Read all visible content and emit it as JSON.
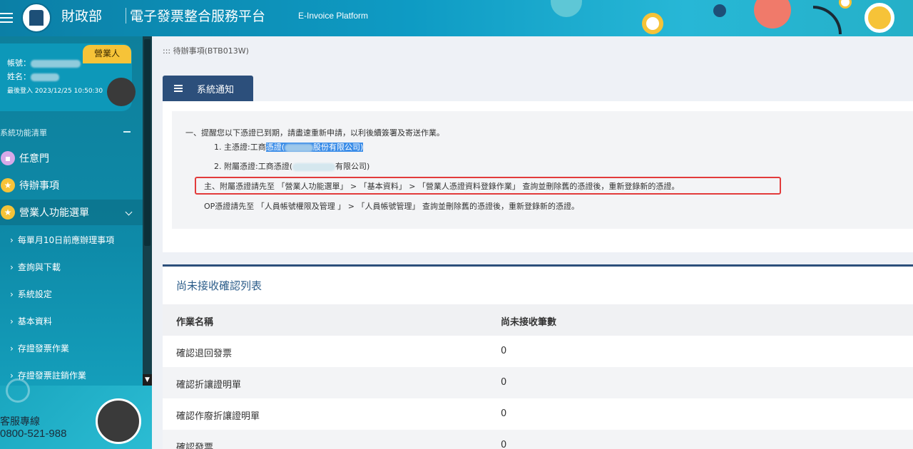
{
  "header": {
    "brand_ministry": "財政部",
    "brand_platform": "電子發票整合服務平台",
    "brand_en": "E-Invoice Platform",
    "colors": {
      "header_bg": "#0e9bc4",
      "accent": "#f6c338",
      "nav_dark": "#2c4f7b"
    }
  },
  "sidebar": {
    "role_badge": "營業人",
    "account_label": "帳號：",
    "account_value": "9 349A CC95",
    "name_label": "姓名：",
    "last_login_label": "最後登入",
    "last_login_value": "2023/12/25 10:50:30",
    "menu_title": "系統功能清單",
    "items": [
      {
        "label": "任意門",
        "icon": "book-icon"
      },
      {
        "label": "待辦事項",
        "icon": "star-icon"
      },
      {
        "label": "營業人功能選單",
        "icon": "star-icon"
      }
    ],
    "sub_items": [
      {
        "label": "每單月10日前應辦理事項"
      },
      {
        "label": "查詢與下載"
      },
      {
        "label": "系統設定"
      },
      {
        "label": "基本資料"
      },
      {
        "label": "存證發票作業"
      },
      {
        "label": "存證發票註銷作業"
      }
    ],
    "support_label": "客服專線",
    "support_phone": "0800-521-988"
  },
  "main": {
    "breadcrumb": "::: 待辦事項(BTB013W)",
    "tab_label": "系統通知",
    "notice": {
      "line1": "一、提醒您以下憑證已到期，請盡速重新申請，以利後續簽署及寄送作業。",
      "item1_prefix": "1. 主憑證:工商",
      "item1_highlight": "憑證(",
      "item1_suffix": "股份有限公司)",
      "item2_prefix": "2. 附屬憑證:工商憑證(",
      "item2_suffix": "有限公司)",
      "boxed_line": "主、附屬憑證請先至 「營業人功能選單」 > 「基本資料」 > 「營業人憑證資料登錄作業」 查詢並刪除舊的憑證後，重新登錄新的憑證。",
      "op_line": "OP憑證請先至 「人員帳號權限及管理 」 > 「人員帳號管理」 查詢並刪除舊的憑證後，重新登錄新的憑證。"
    },
    "pending_title": "尚未接收確認列表",
    "table": {
      "headers": [
        "作業名稱",
        "尚未接收筆數"
      ],
      "rows": [
        {
          "name": "確認退回發票",
          "count": "0"
        },
        {
          "name": "確認折讓證明單",
          "count": "0"
        },
        {
          "name": "確認作廢折讓證明單",
          "count": "0"
        },
        {
          "name": "確認發票",
          "count": "0"
        }
      ]
    }
  }
}
